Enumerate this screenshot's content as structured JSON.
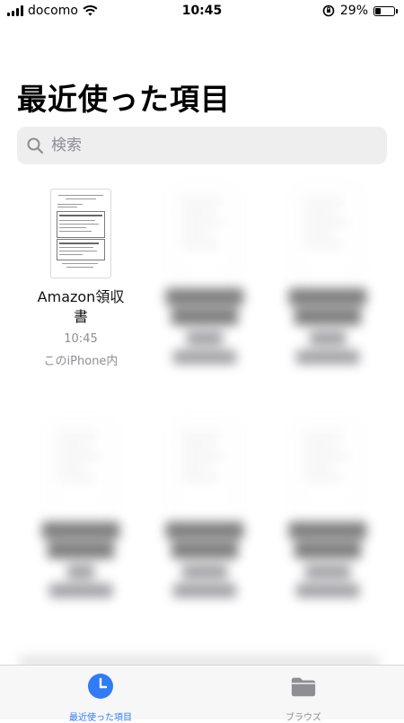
{
  "status_bar": {
    "carrier": "docomo",
    "time": "10:45",
    "battery": "29%",
    "battery_level": 0.29
  },
  "page_title": "最近使った項目",
  "search": {
    "placeholder": "検索"
  },
  "files": [
    {
      "name": "Amazon領収書",
      "name_line1": "Amazon領収",
      "name_line2": "書",
      "time": "10:45",
      "location": "このiPhone内",
      "blurred": false
    },
    {
      "name": "",
      "blurred": true
    },
    {
      "name": "",
      "blurred": true
    },
    {
      "name": "",
      "blurred": true
    },
    {
      "name": "",
      "blurred": true
    },
    {
      "name": "",
      "blurred": true
    }
  ],
  "tabbar": {
    "recents": {
      "label": "最近使った項目",
      "color": "#2f7cf6"
    },
    "browse": {
      "label": "ブラウズ",
      "color": "#8e8e93"
    }
  },
  "colors": {
    "accent": "#2f7cf6",
    "search_bg": "#eeeeef"
  }
}
